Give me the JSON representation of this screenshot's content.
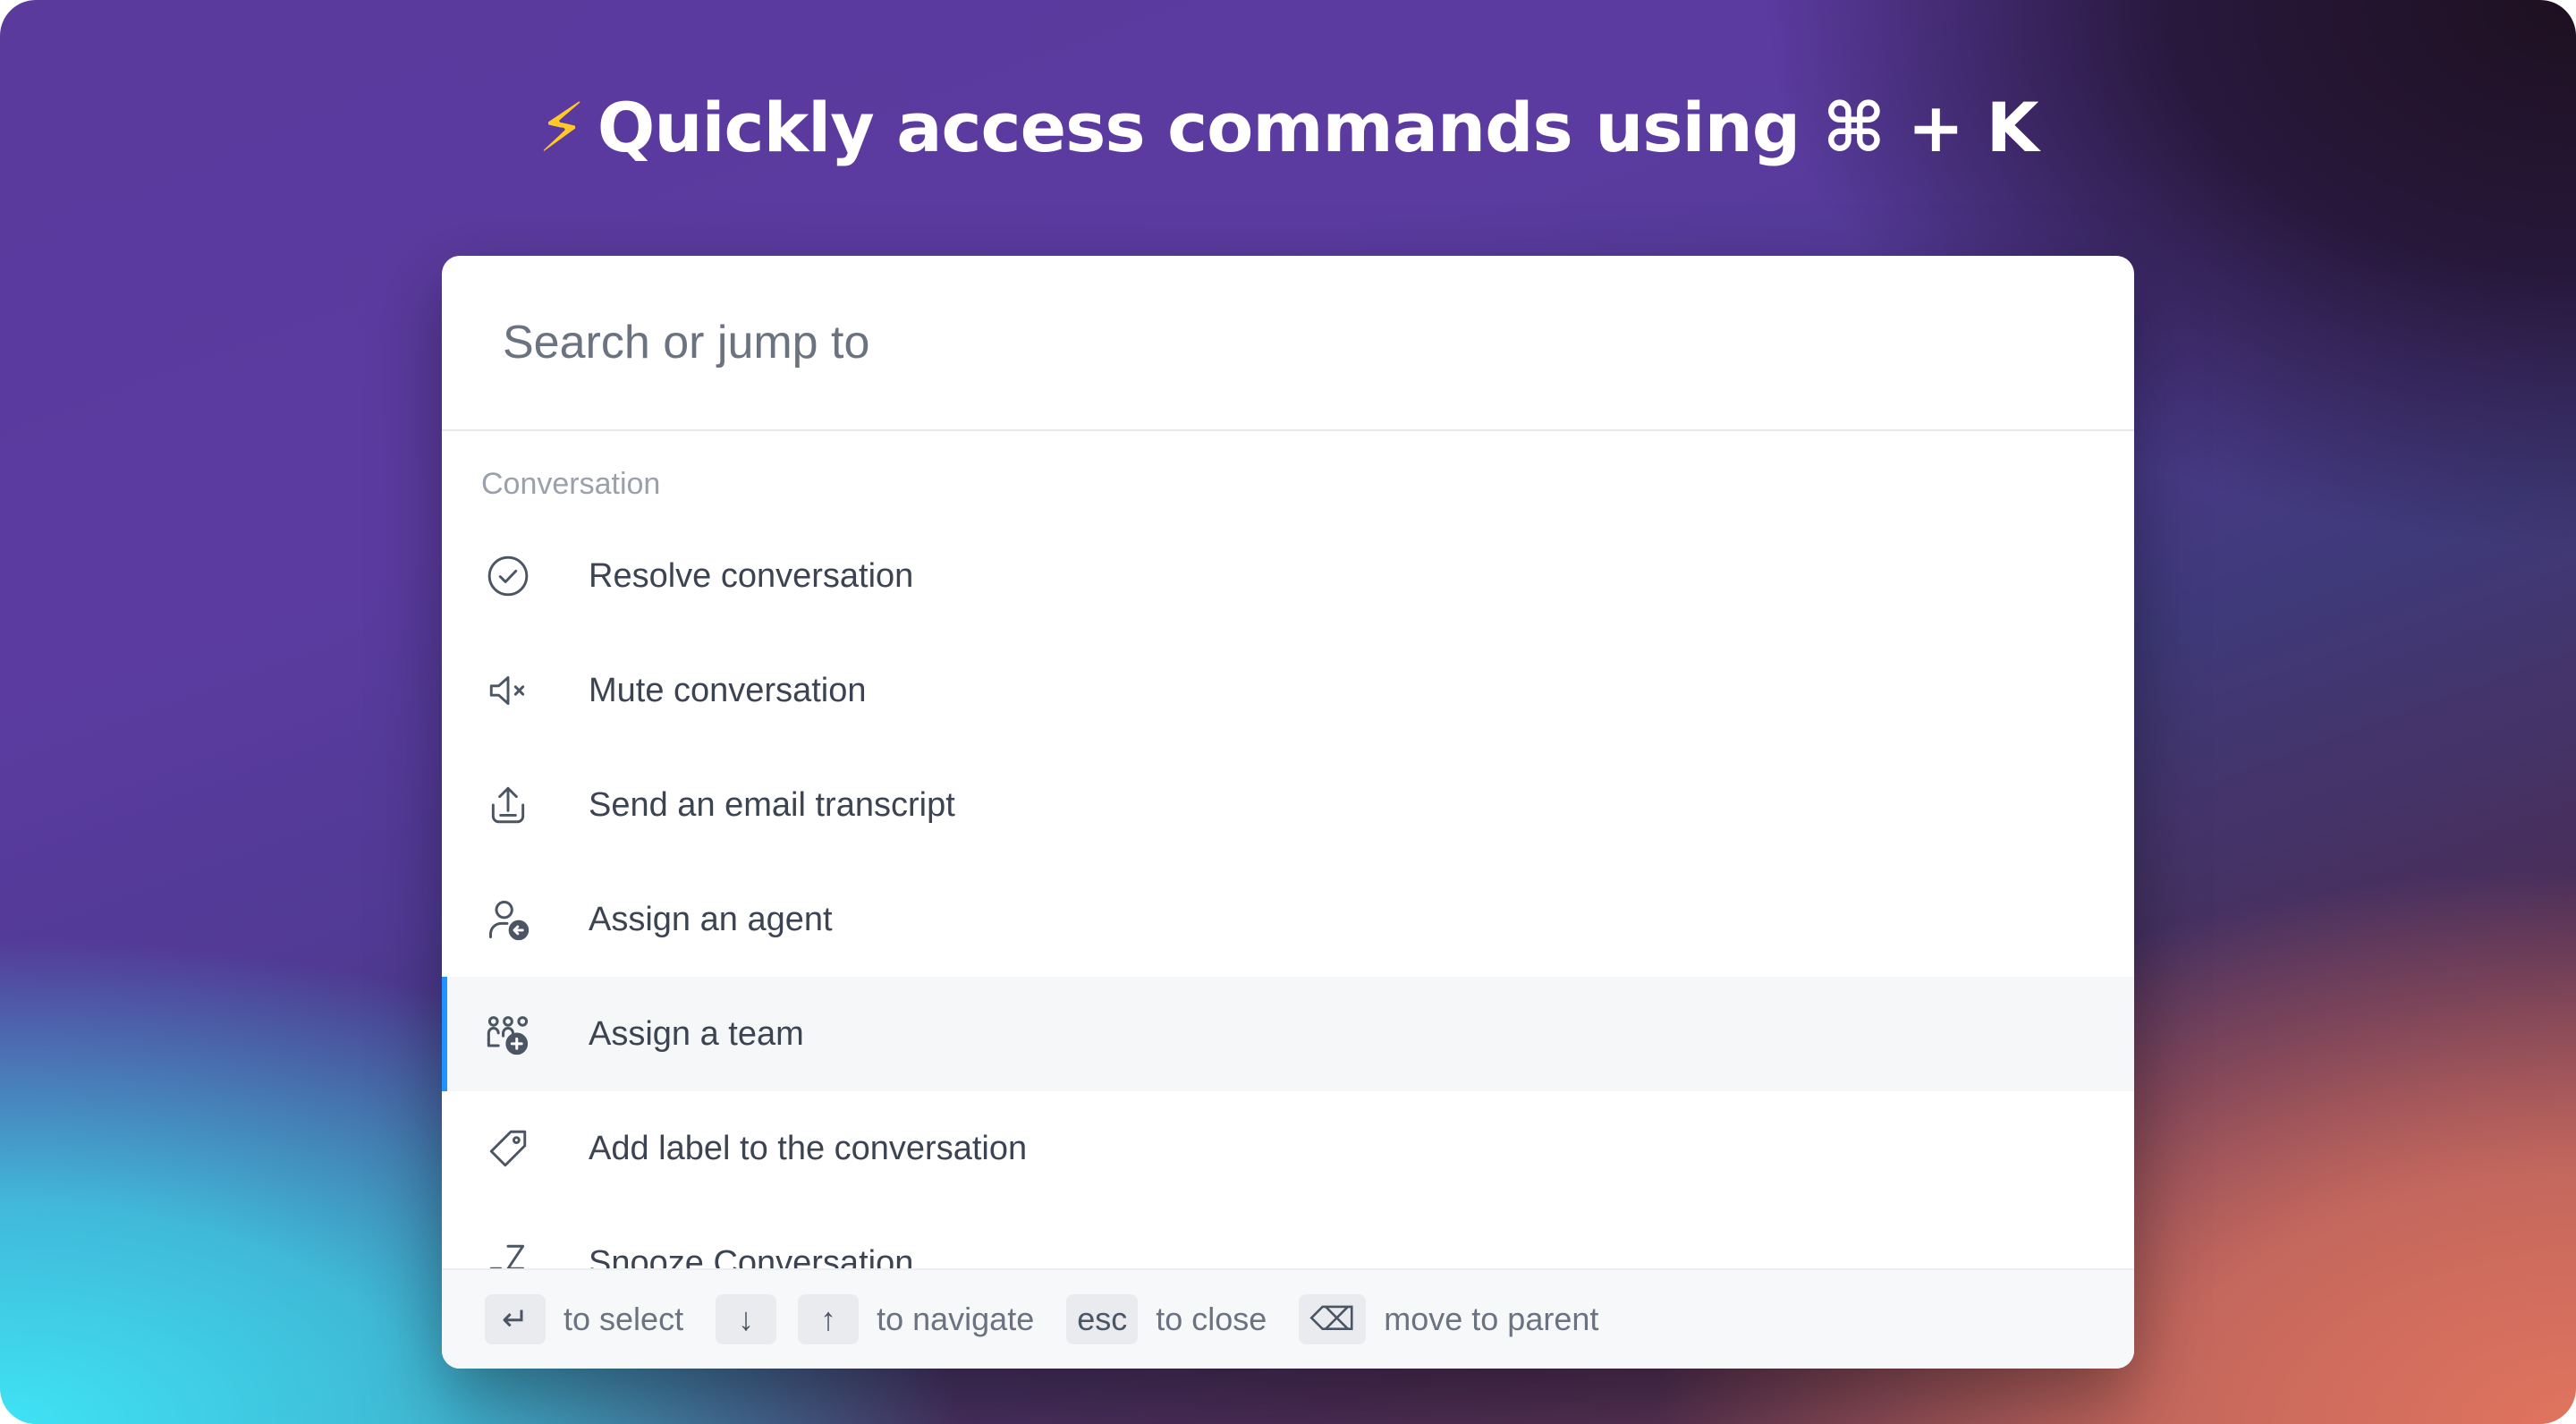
{
  "headline": {
    "bolt": "⚡",
    "text": "Quickly access commands using ⌘ + K"
  },
  "search": {
    "placeholder": "Search or jump to"
  },
  "group": {
    "title": "Conversation"
  },
  "commands": [
    {
      "label": "Resolve conversation",
      "icon": "check-circle-icon"
    },
    {
      "label": "Mute conversation",
      "icon": "speaker-mute-icon"
    },
    {
      "label": "Send an email transcript",
      "icon": "share-upload-icon"
    },
    {
      "label": "Assign an agent",
      "icon": "person-assign-icon"
    },
    {
      "label": "Assign a team",
      "icon": "team-add-icon",
      "active": true
    },
    {
      "label": "Add label to the conversation",
      "icon": "tag-icon"
    },
    {
      "label": "Snooze Conversation",
      "icon": "snooze-icon"
    }
  ],
  "footer": {
    "select_key": "↵",
    "select_hint": "to select",
    "down_key": "↓",
    "up_key": "↑",
    "navigate_hint": "to navigate",
    "esc_key": "esc",
    "close_hint": "to close",
    "backspace_key": "⌫",
    "parent_hint": "move to parent"
  },
  "colors": {
    "accent": "#1f93ff",
    "active_row": "#f5f7f9",
    "bolt": "#ffc928"
  }
}
